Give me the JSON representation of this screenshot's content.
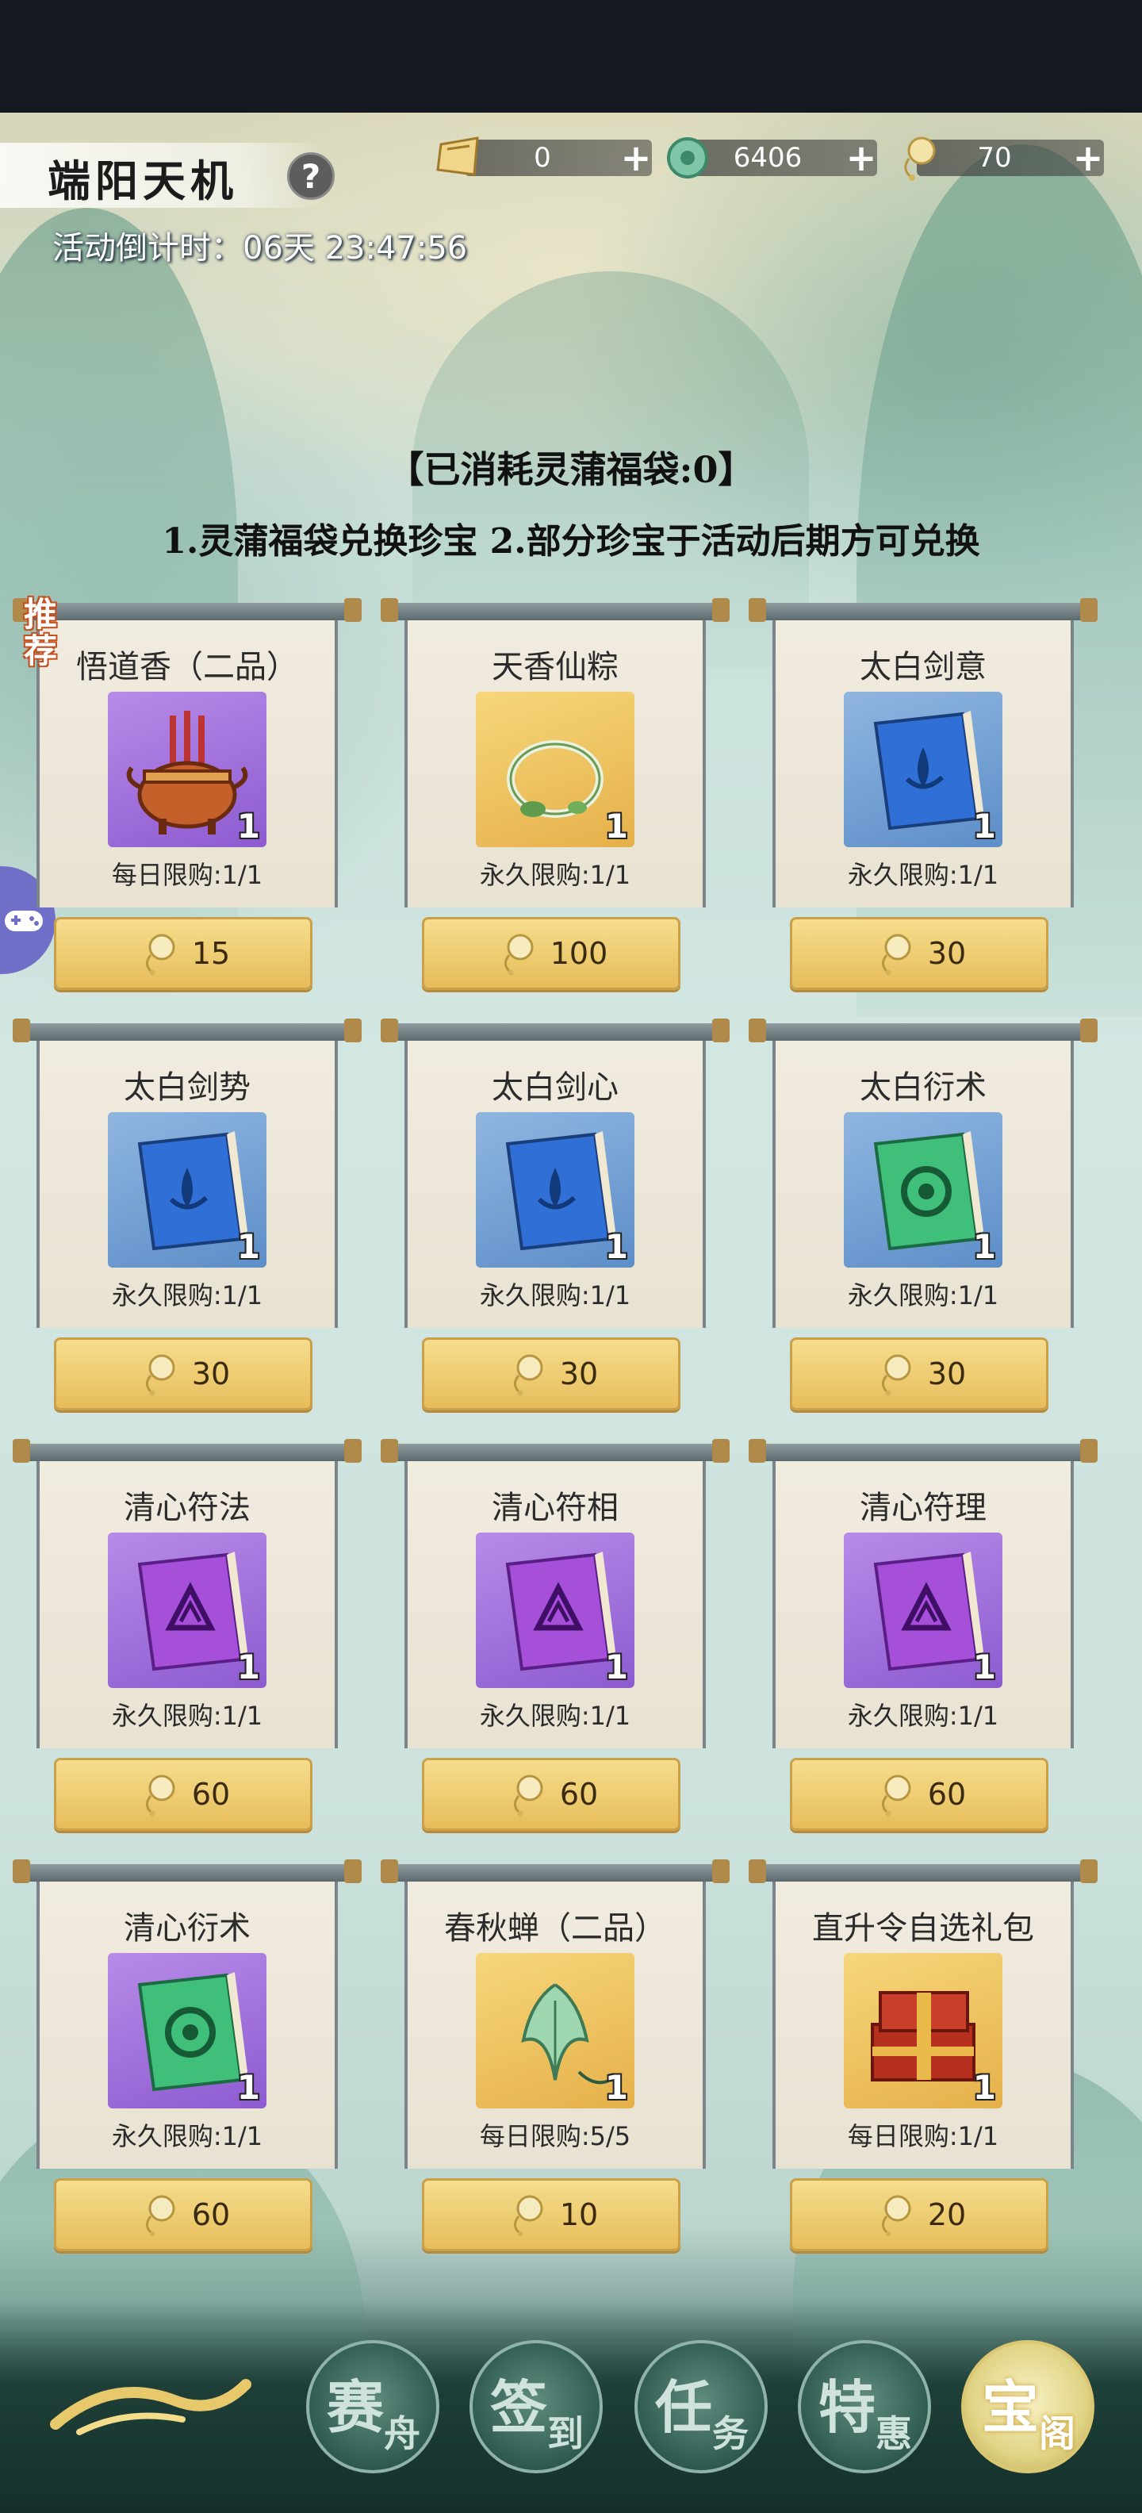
{
  "header": {
    "title": "端阳天机",
    "countdown_label": "活动倒计时：",
    "countdown_value": "06天 23:47:56",
    "currencies": [
      {
        "icon": "ticket-icon",
        "value": "0"
      },
      {
        "icon": "jade-icon",
        "value": "6406"
      },
      {
        "icon": "sachet-coin-icon",
        "value": "70"
      }
    ]
  },
  "headline": "【已消耗灵蒲福袋:0】",
  "subline": "1.灵蒲福袋兑换珍宝 2.部分珍宝于活动后期方可兑换",
  "recommend_badge": "推荐",
  "items": [
    {
      "name": "悟道香（二品）",
      "limit": "每日限购:1/1",
      "price": "15",
      "qty": "1",
      "bg": "purple",
      "icon": "incense-burner-icon"
    },
    {
      "name": "天香仙粽",
      "limit": "永久限购:1/1",
      "price": "100",
      "qty": "1",
      "bg": "gold",
      "icon": "jade-ring-icon"
    },
    {
      "name": "太白剑意",
      "limit": "永久限购:1/1",
      "price": "30",
      "qty": "1",
      "bg": "blue",
      "icon": "blue-book-icon"
    },
    {
      "name": "太白剑势",
      "limit": "永久限购:1/1",
      "price": "30",
      "qty": "1",
      "bg": "blue",
      "icon": "blue-book-icon"
    },
    {
      "name": "太白剑心",
      "limit": "永久限购:1/1",
      "price": "30",
      "qty": "1",
      "bg": "blue",
      "icon": "blue-book-icon"
    },
    {
      "name": "太白衍术",
      "limit": "永久限购:1/1",
      "price": "30",
      "qty": "1",
      "bg": "blue",
      "icon": "green-book-icon"
    },
    {
      "name": "清心符法",
      "limit": "永久限购:1/1",
      "price": "60",
      "qty": "1",
      "bg": "purple",
      "icon": "purple-book-icon"
    },
    {
      "name": "清心符相",
      "limit": "永久限购:1/1",
      "price": "60",
      "qty": "1",
      "bg": "purple",
      "icon": "purple-book-icon"
    },
    {
      "name": "清心符理",
      "limit": "永久限购:1/1",
      "price": "60",
      "qty": "1",
      "bg": "purple",
      "icon": "purple-book-icon"
    },
    {
      "name": "清心衍术",
      "limit": "永久限购:1/1",
      "price": "60",
      "qty": "1",
      "bg": "purple",
      "icon": "green-book-icon"
    },
    {
      "name": "春秋蝉（二品）",
      "limit": "每日限购:5/5",
      "price": "10",
      "qty": "1",
      "bg": "gold",
      "icon": "jade-cicada-icon"
    },
    {
      "name": "直升令自选礼包",
      "limit": "每日限购:1/1",
      "price": "20",
      "qty": "1",
      "bg": "gold",
      "icon": "gift-box-icon"
    }
  ],
  "nav": [
    {
      "big": "赛",
      "small": "舟",
      "name": "nav-dragon-boat"
    },
    {
      "big": "签",
      "small": "到",
      "name": "nav-sign-in"
    },
    {
      "big": "任",
      "small": "务",
      "name": "nav-tasks"
    },
    {
      "big": "特",
      "small": "惠",
      "name": "nav-special-offers"
    },
    {
      "big": "宝",
      "small": "阁",
      "name": "nav-treasure-pavilion",
      "active": true
    }
  ],
  "colors": {
    "purple_bg": "#8d5bd0",
    "gold_bg": "#e6b04a",
    "blue_bg": "#5d8ec8",
    "button_gold": "#e6bd5a"
  }
}
